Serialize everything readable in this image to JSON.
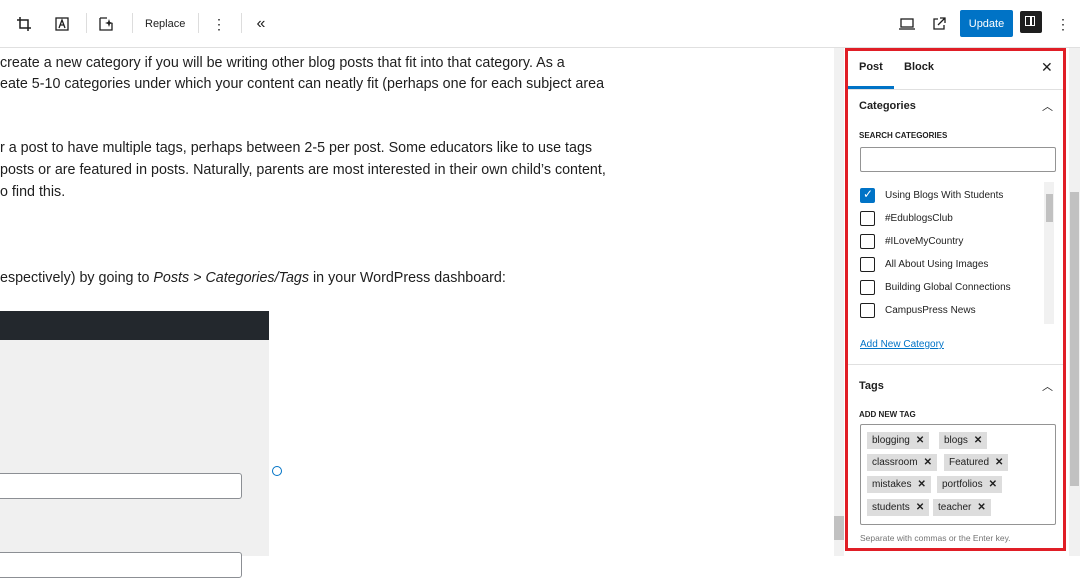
{
  "toolbar": {
    "replace_label": "Replace",
    "update_label": "Update"
  },
  "content": {
    "paragraphs": [
      "create a new category if you will be writing other blog posts that fit into that category. As a",
      "eate 5-10 categories under which your content can neatly fit (perhaps one for each subject area",
      "r a post to have multiple tags, perhaps between 2-5 per post. Some educators like to use tags",
      "posts or are featured in posts. Naturally, parents are most interested in their own child’s content,",
      "o find this."
    ],
    "dashboard_line": {
      "before": "espectively) by going to ",
      "italic": "Posts > Categories/Tags",
      "after": " in your WordPress dashboard:"
    }
  },
  "sidebar": {
    "tabs": [
      "Post",
      "Block"
    ],
    "categories": {
      "title": "Categories",
      "search_label": "SEARCH CATEGORIES",
      "search_value": "",
      "items": [
        {
          "label": "Using Blogs With Students",
          "checked": true
        },
        {
          "label": "#EdublogsClub",
          "checked": false
        },
        {
          "label": "#ILoveMyCountry",
          "checked": false
        },
        {
          "label": "All About Using Images",
          "checked": false
        },
        {
          "label": "Building Global Connections",
          "checked": false
        },
        {
          "label": "CampusPress News",
          "checked": false
        }
      ],
      "add_new": "Add New Category"
    },
    "tags": {
      "title": "Tags",
      "add_label": "ADD NEW TAG",
      "items": [
        "blogging",
        "blogs",
        "classroom",
        "Featured",
        "mistakes",
        "portfolios",
        "students",
        "teacher"
      ],
      "help": "Separate with commas or the Enter key."
    }
  },
  "colors": {
    "accent": "#0073c6",
    "highlight_border": "#e01e26"
  }
}
